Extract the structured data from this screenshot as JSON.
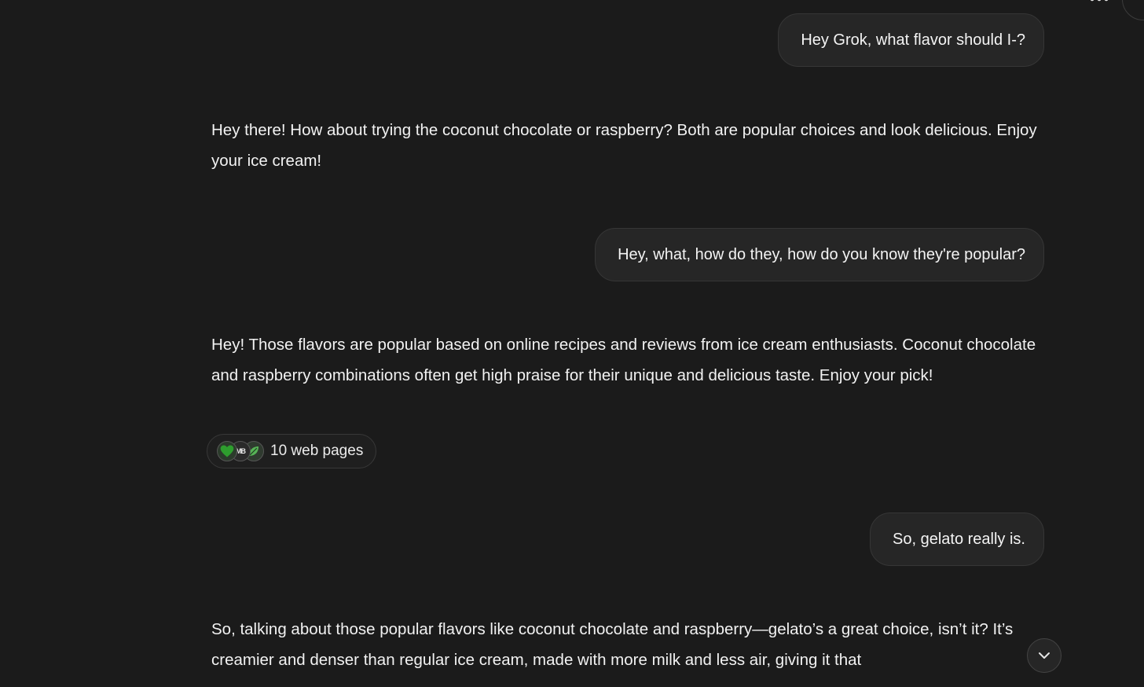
{
  "conversation": {
    "messages": [
      {
        "role": "user",
        "text": "Hey Grok, what flavor should I-?"
      },
      {
        "role": "assistant",
        "text": "Hey there! How about trying the coconut chocolate or raspberry? Both are popular choices and look delicious. Enjoy your ice cream!"
      },
      {
        "role": "user",
        "text": "Hey, what, how do they, how do you know they're popular?"
      },
      {
        "role": "assistant",
        "text": "Hey! Those flavors are popular based on online recipes and reviews from ice cream enthusiasts. Coconut chocolate and raspberry combinations often get high praise for their unique and delicious taste. Enjoy your pick!"
      },
      {
        "role": "user",
        "text": "So, gelato really is."
      },
      {
        "role": "assistant",
        "text": "So, talking about those popular flavors like coconut chocolate and raspberry—gelato’s a great choice, isn’t it? It’s creamier and denser than regular ice cream, made with more milk and less air, giving it that"
      }
    ],
    "sources": {
      "label": "10 web pages",
      "favicons": [
        "heart-favicon-icon",
        "mb-favicon-icon",
        "leaf-favicon-icon"
      ],
      "mb_text": "MB"
    }
  },
  "controls": {
    "more_icon": "more-horizontal-icon",
    "scroll_down_icon": "chevron-down-icon"
  },
  "colors": {
    "background": "#1b1b1b",
    "bubble": "#262626",
    "text": "#f2f2f2",
    "favicon_green": "#2e9e2e"
  }
}
